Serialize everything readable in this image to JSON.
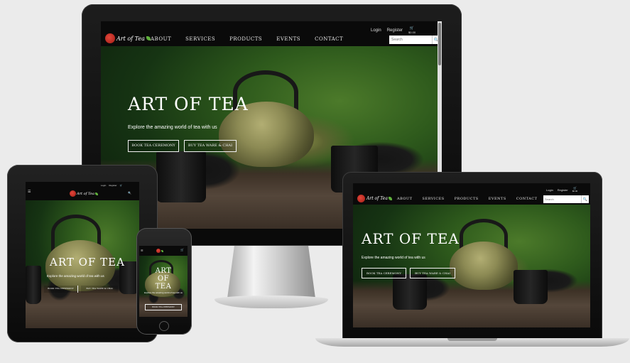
{
  "site": {
    "logo_text": "Art of Tea",
    "nav": [
      "ABOUT",
      "SERVICES",
      "PRODUCTS",
      "EVENTS",
      "CONTACT"
    ],
    "util": {
      "login": "Login",
      "register": "Register",
      "cart": "$0.00"
    },
    "search_placeholder": "Search",
    "hero_title": "ART OF TEA",
    "hero_subtitle": "Explore the amazing world of tea with us",
    "cta_primary": "BOOK TEA CEREMONY",
    "cta_secondary": "BUY TEA WARE & CHAI",
    "menu_icon": "☰",
    "cart_icon": "🛒",
    "search_icon": "🔍"
  },
  "tablet": {
    "util": {
      "login": "Login",
      "register": "Register"
    }
  },
  "colors": {
    "nav_bg": "#0a0a0a",
    "hero_green": "#2e5a1c",
    "logo_red": "#c72a21",
    "leaf_green": "#5fb03b"
  }
}
